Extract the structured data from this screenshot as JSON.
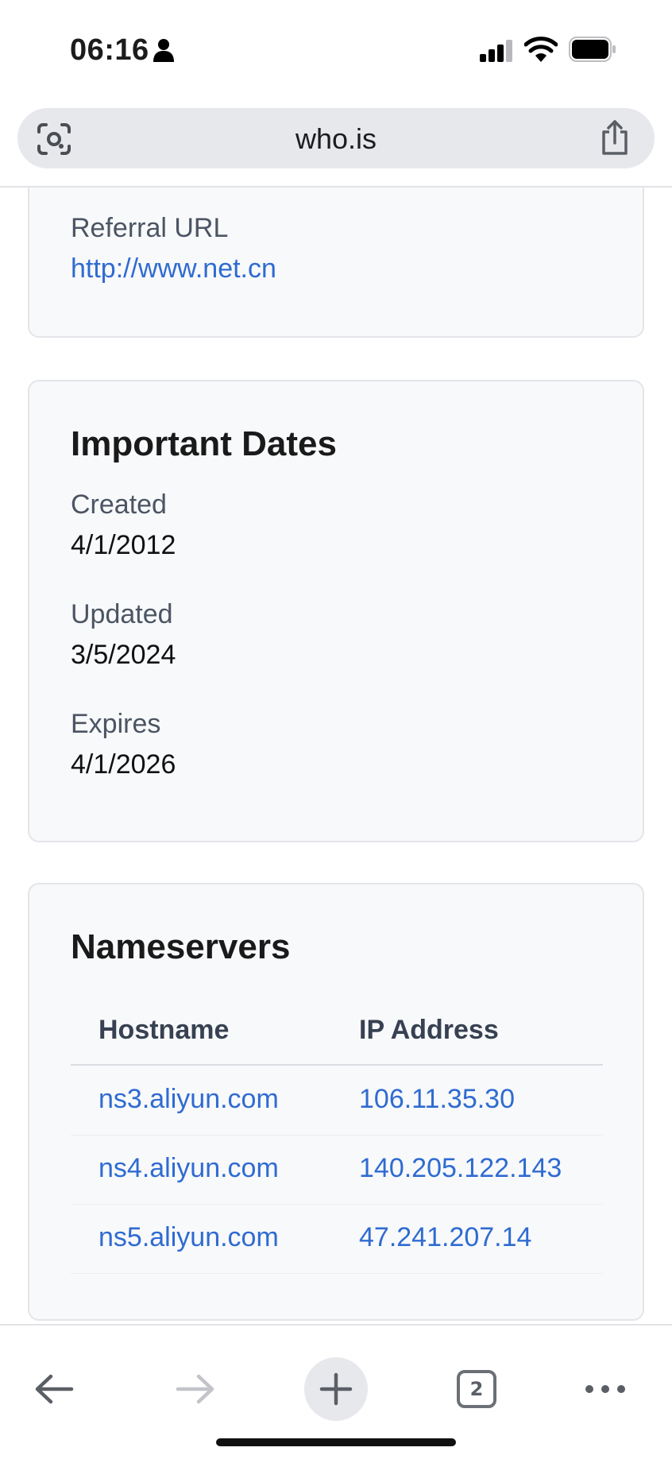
{
  "status_bar": {
    "time": "06:16"
  },
  "browser": {
    "url": "who.is",
    "tab_count": "2"
  },
  "referral": {
    "label": "Referral URL",
    "value": "http://www.net.cn"
  },
  "important_dates": {
    "title": "Important Dates",
    "created_label": "Created",
    "created_value": "4/1/2012",
    "updated_label": "Updated",
    "updated_value": "3/5/2024",
    "expires_label": "Expires",
    "expires_value": "4/1/2026"
  },
  "nameservers": {
    "title": "Nameservers",
    "columns": [
      "Hostname",
      "IP Address"
    ],
    "rows": [
      {
        "hostname": "ns3.aliyun.com",
        "ip": "106.11.35.30"
      },
      {
        "hostname": "ns4.aliyun.com",
        "ip": "140.205.122.143"
      },
      {
        "hostname": "ns5.aliyun.com",
        "ip": "47.241.207.14"
      }
    ]
  },
  "colors": {
    "link": "#2f6bd1",
    "card_bg": "#f8f9fb",
    "url_bar_bg": "#e7e8ec"
  },
  "icons": [
    "person-icon",
    "signal-icon",
    "wifi-icon",
    "battery-icon",
    "lens-icon",
    "share-icon",
    "back-arrow-icon",
    "forward-arrow-icon",
    "plus-icon",
    "more-dots-icon"
  ]
}
